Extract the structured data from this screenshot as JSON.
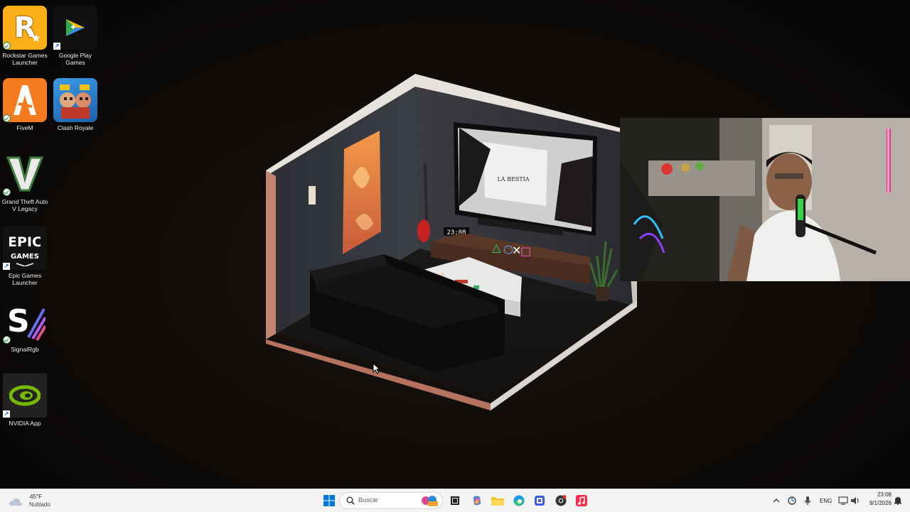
{
  "desktop": {
    "icons": [
      {
        "label": "Rockstar Games Launcher",
        "icon": "rockstar-icon",
        "color": "#fcaf17"
      },
      {
        "label": "Google Play Games",
        "icon": "google-play-games-icon",
        "color": "#1aa260"
      },
      {
        "label": "FiveM",
        "icon": "fivem-icon",
        "color": "#f47b20"
      },
      {
        "label": "Clash Royale",
        "icon": "clash-royale-icon",
        "color": "#2f8fe0"
      },
      {
        "label": "Grand Theft Auto V Legacy",
        "icon": "gta-v-icon",
        "color": "#3f7d3f"
      },
      {
        "label": "Epic Games Launcher",
        "icon": "epic-games-icon",
        "color": "#121212"
      },
      {
        "label": "SignalRgb",
        "icon": "signalrgb-icon",
        "color": "#8c5cf0"
      },
      {
        "label": "NVIDIA App",
        "icon": "nvidia-icon",
        "color": "#76b900"
      }
    ]
  },
  "room": {
    "clock": "23:08",
    "poster_text": "LA BESTIA"
  },
  "taskbar": {
    "weather": {
      "temp": "45°F",
      "condition": "Nublado"
    },
    "search_placeholder": "Buscar",
    "apps": [
      "windows-start-icon",
      "search-icon",
      "task-view-icon",
      "copilot-icon",
      "file-explorer-icon",
      "edge-icon",
      "app-icon",
      "chrome-icon",
      "music-icon"
    ],
    "tray": {
      "language": "ENG",
      "time": "23:08",
      "date": "9/1/2026"
    }
  }
}
